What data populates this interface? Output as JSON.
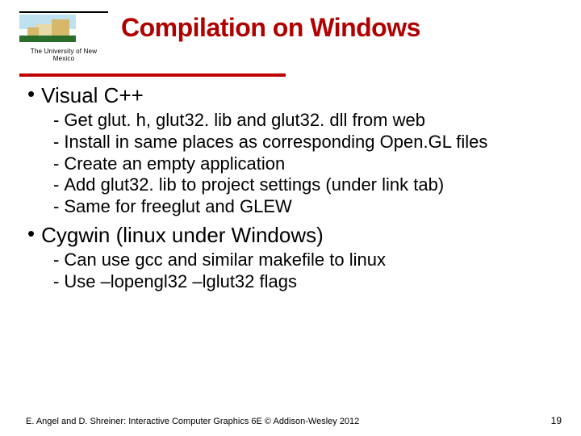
{
  "logo": {
    "caption": "The University of New Mexico"
  },
  "title": "Compilation on Windows",
  "sections": [
    {
      "heading": "Visual C++",
      "items": [
        "Get glut. h, glut32. lib and glut32. dll from web",
        "Install in same places as corresponding Open.GL files",
        "Create an empty application",
        "Add glut32. lib to project settings (under link tab)",
        "Same for freeglut and GLEW"
      ]
    },
    {
      "heading": "Cygwin (linux under Windows)",
      "items": [
        "Can use gcc and similar makefile to linux",
        "Use –lopengl32 –lglut32 flags"
      ]
    }
  ],
  "footer": {
    "credit": "E. Angel and D. Shreiner: Interactive Computer Graphics 6E © Addison-Wesley 2012",
    "page": "19"
  }
}
